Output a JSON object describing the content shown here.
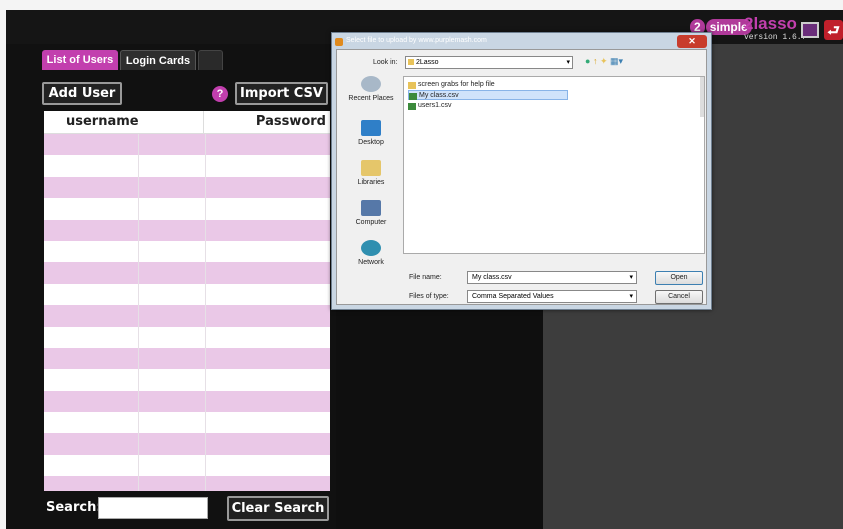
{
  "branding": {
    "logo_2simple_prefix": "2",
    "logo_2simple_suffix": "simple",
    "logo_2lasso": "2lasso",
    "version": "version 1.6.7"
  },
  "tabs": [
    {
      "label": "List of Users",
      "active": true
    },
    {
      "label": "Login Cards",
      "active": false
    }
  ],
  "toolbar": {
    "add_user_label": "Add User",
    "help_glyph": "?",
    "import_csv_label": "Import CSV"
  },
  "table": {
    "columns": [
      "username",
      "Password"
    ],
    "row_count": 17
  },
  "search": {
    "label": "Search:",
    "value": "",
    "clear_label": "Clear Search"
  },
  "dialog": {
    "title": "Select file to upload by www.purplemash.com",
    "close_glyph": "✕",
    "look_in_label": "Look in:",
    "look_in_value": "2Lasso",
    "places": [
      "Recent Places",
      "Desktop",
      "Libraries",
      "Computer",
      "Network"
    ],
    "files": [
      {
        "name": "screen grabs for help file",
        "type": "folder",
        "selected": false
      },
      {
        "name": "My class.csv",
        "type": "csv",
        "selected": true
      },
      {
        "name": "users1.csv",
        "type": "csv",
        "selected": false
      }
    ],
    "file_name_label": "File name:",
    "file_name_value": "My class.csv",
    "files_of_type_label": "Files of type:",
    "files_of_type_value": "Comma Separated Values",
    "open_label": "Open",
    "cancel_label": "Cancel"
  },
  "colors": {
    "accent": "#c23fae",
    "row_pink": "#eac8e7"
  }
}
